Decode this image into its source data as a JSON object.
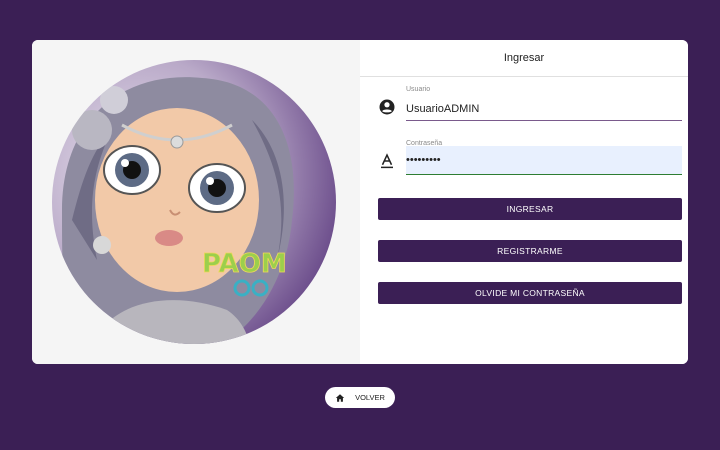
{
  "login": {
    "title": "Ingresar",
    "username": {
      "label": "Usuario",
      "value": "UsuarioADMIN",
      "icon": "account-circle-icon"
    },
    "password": {
      "label": "Contraseña",
      "value": "•••••••••",
      "icon": "font-a-icon"
    },
    "buttons": {
      "login": "INGRESAR",
      "register": "REGISTRARME",
      "forgot": "OLVIDE MI CONTRASEÑA"
    }
  },
  "footer": {
    "back_label": "VOLVER",
    "back_icon": "home-icon"
  },
  "logo_text": "PAOM",
  "colors": {
    "primary": "#3b1f55",
    "accent": "#7a5a8c",
    "field_bg": "#e8f0fe"
  }
}
